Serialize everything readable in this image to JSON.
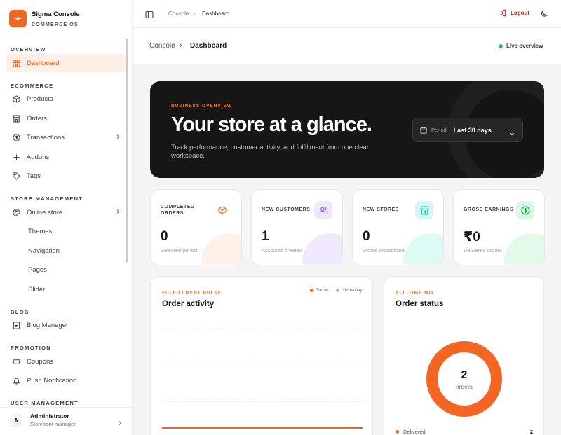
{
  "brand": {
    "name": "Sigma Console",
    "subtitle": "COMMERCE OS"
  },
  "sidebar": {
    "sections": {
      "overview": "OVERVIEW",
      "ecommerce": "ECOMMERCE",
      "store_management": "STORE MANAGEMENT",
      "blog": "BLOG",
      "promotion": "PROMOTION",
      "user_management": "USER MANAGEMENT"
    },
    "items": {
      "dashboard": "Dashboard",
      "products": "Products",
      "orders": "Orders",
      "transactions": "Transactions",
      "addons": "Addons",
      "tags": "Tags",
      "online_store": "Online store",
      "themes": "Themes",
      "navigation": "Navigation",
      "pages": "Pages",
      "slider": "Slider",
      "blog_manager": "Blog Manager",
      "coupons": "Coupons",
      "push_notification": "Push Notification"
    },
    "user": {
      "initial": "A",
      "name": "Administrator",
      "role": "Storefront manager"
    }
  },
  "topbar": {
    "crumb_parent": "Console",
    "crumb_sep": "›",
    "crumb_current": "Dashboard",
    "logout": "Logout"
  },
  "header": {
    "crumb_parent": "Console",
    "crumb_sep": "›",
    "crumb_current": "Dashboard",
    "status": "Live overview"
  },
  "hero": {
    "eyebrow": "BUSINESS OVERVIEW",
    "title": "Your store at a glance.",
    "description": "Track performance, customer activity, and fulfillment from one clear workspace.",
    "period_label": "Period",
    "period_value": "Last 30 days"
  },
  "stats": [
    {
      "label": "COMPLETED ORDERS",
      "value": "0",
      "sub": "Selected period",
      "icon": "box-icon",
      "color": "#f26522"
    },
    {
      "label": "NEW CUSTOMERS",
      "value": "1",
      "sub": "Accounts created",
      "icon": "users-icon",
      "color": "#8b5cf6"
    },
    {
      "label": "NEW STORES",
      "value": "0",
      "sub": "Stores onboarded",
      "icon": "store-icon",
      "color": "#14b8a6"
    },
    {
      "label": "GROSS EARNINGS",
      "value": "₹0",
      "sub": "Delivered orders",
      "icon": "dollar-icon",
      "color": "#22c55e"
    }
  ],
  "activity": {
    "eyebrow": "FULFILLMENT PULSE",
    "title": "Order activity",
    "legend_today": "Today",
    "legend_yesterday": "Yesterday"
  },
  "mix": {
    "eyebrow": "ALL-TIME MIX",
    "title": "Order status",
    "total": "2",
    "total_label": "orders",
    "rows": [
      {
        "label": "Delivered",
        "count": "2"
      }
    ]
  },
  "colors": {
    "accent": "#f26522",
    "danger": "#b91c1c",
    "live": "#22c55e"
  }
}
